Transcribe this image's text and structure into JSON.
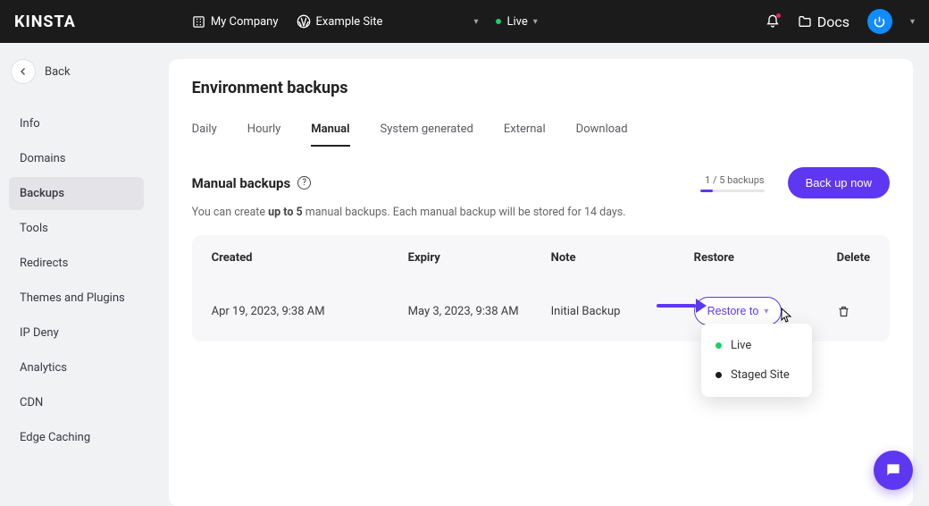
{
  "topbar": {
    "logo": "KINSTA",
    "company": "My Company",
    "site": "Example Site",
    "env": "Live",
    "docs": "Docs"
  },
  "sidebar": {
    "back": "Back",
    "items": [
      "Info",
      "Domains",
      "Backups",
      "Tools",
      "Redirects",
      "Themes and Plugins",
      "IP Deny",
      "Analytics",
      "CDN",
      "Edge Caching"
    ],
    "active_index": 2
  },
  "page": {
    "title": "Environment backups",
    "tabs": [
      "Daily",
      "Hourly",
      "Manual",
      "System generated",
      "External",
      "Download"
    ],
    "active_tab": 2,
    "section_title": "Manual backups",
    "counter": "1 / 5 backups",
    "backup_btn": "Back up now",
    "desc_pre": "You can create ",
    "desc_bold": "up to 5",
    "desc_post": " manual backups. Each manual backup will be stored for 14 days.",
    "cols": {
      "created": "Created",
      "expiry": "Expiry",
      "note": "Note",
      "restore": "Restore",
      "delete": "Delete"
    },
    "row": {
      "created": "Apr 19, 2023, 9:38 AM",
      "expiry": "May 3, 2023, 9:38 AM",
      "note": "Initial Backup",
      "restore_btn": "Restore to"
    },
    "dropdown": {
      "opt1": "Live",
      "opt2": "Staged Site"
    }
  }
}
